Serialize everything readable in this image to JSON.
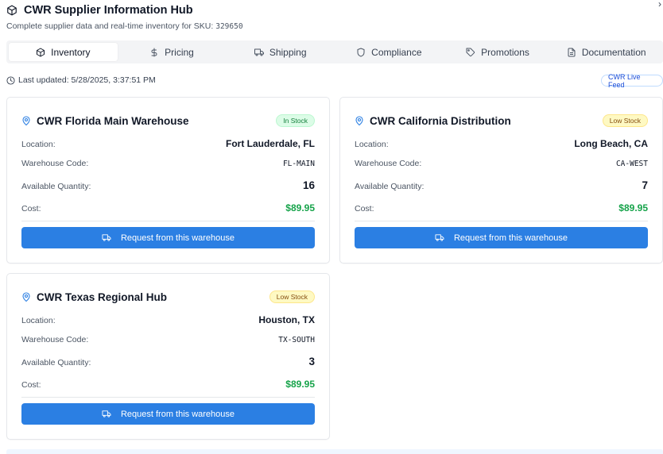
{
  "header": {
    "title": "CWR Supplier Information Hub",
    "subtitle_prefix": "Complete supplier data and real-time inventory for SKU: ",
    "sku": "329650"
  },
  "tabs": [
    {
      "label": "Inventory",
      "icon": "package-icon",
      "active": true
    },
    {
      "label": "Pricing",
      "icon": "dollar-icon",
      "active": false
    },
    {
      "label": "Shipping",
      "icon": "truck-icon",
      "active": false
    },
    {
      "label": "Compliance",
      "icon": "shield-icon",
      "active": false
    },
    {
      "label": "Promotions",
      "icon": "tag-icon",
      "active": false
    },
    {
      "label": "Documentation",
      "icon": "document-icon",
      "active": false
    }
  ],
  "status": {
    "last_updated": "Last updated: 5/28/2025, 3:37:51 PM",
    "live_badge": "CWR Live Feed"
  },
  "labels": {
    "location": "Location:",
    "warehouse_code": "Warehouse Code:",
    "available_quantity": "Available Quantity:",
    "cost": "Cost:",
    "request_button": "Request from this warehouse"
  },
  "warehouses": [
    {
      "name": "CWR Florida Main Warehouse",
      "stock_status": "In Stock",
      "location": "Fort Lauderdale, FL",
      "code": "FL-MAIN",
      "quantity": "16",
      "cost": "$89.95"
    },
    {
      "name": "CWR California Distribution",
      "stock_status": "Low Stock",
      "location": "Long Beach, CA",
      "code": "CA-WEST",
      "quantity": "7",
      "cost": "$89.95"
    },
    {
      "name": "CWR Texas Regional Hub",
      "stock_status": "Low Stock",
      "location": "Houston, TX",
      "code": "TX-SOUTH",
      "quantity": "3",
      "cost": "$89.95"
    }
  ],
  "colors": {
    "accent": "#2b7fe3",
    "in_stock": "#15803d",
    "low_stock": "#854d0e",
    "cost": "#16a34a"
  },
  "close_glyph": "›"
}
